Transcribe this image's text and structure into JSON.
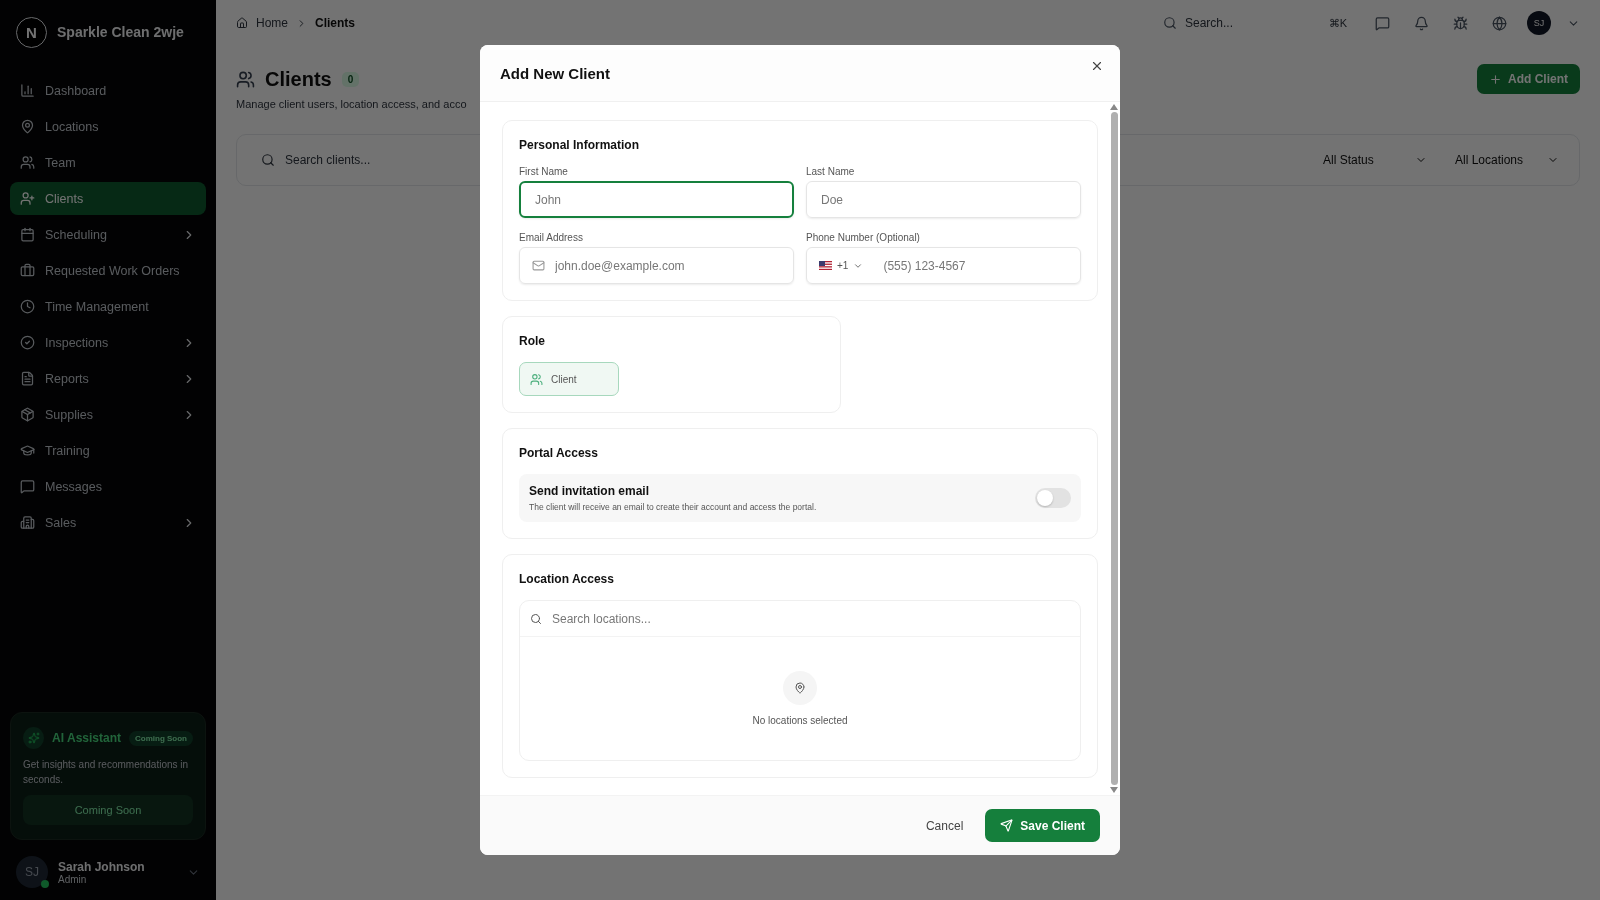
{
  "sidebar": {
    "brand": {
      "logo": "N",
      "name": "Sparkle Clean 2wje"
    },
    "items": [
      {
        "label": "Dashboard",
        "selected": false,
        "expandable": false
      },
      {
        "label": "Locations",
        "selected": false,
        "expandable": false
      },
      {
        "label": "Team",
        "selected": false,
        "expandable": false
      },
      {
        "label": "Clients",
        "selected": true,
        "expandable": false
      },
      {
        "label": "Scheduling",
        "selected": false,
        "expandable": true
      },
      {
        "label": "Requested Work Orders",
        "selected": false,
        "expandable": false
      },
      {
        "label": "Time Management",
        "selected": false,
        "expandable": false
      },
      {
        "label": "Inspections",
        "selected": false,
        "expandable": true
      },
      {
        "label": "Reports",
        "selected": false,
        "expandable": true
      },
      {
        "label": "Supplies",
        "selected": false,
        "expandable": true
      },
      {
        "label": "Training",
        "selected": false,
        "expandable": false
      },
      {
        "label": "Messages",
        "selected": false,
        "expandable": false
      },
      {
        "label": "Sales",
        "selected": false,
        "expandable": true
      }
    ],
    "ai_card": {
      "title": "AI Assistant",
      "badge": "Coming Soon",
      "text": "Get insights and recommendations in seconds.",
      "button": "Coming Soon"
    },
    "user": {
      "initials": "SJ",
      "name": "Sarah Johnson",
      "role": "Admin",
      "online": true
    }
  },
  "header": {
    "breadcrumb": [
      "Home",
      "Clients"
    ],
    "search": {
      "placeholder": "Search...",
      "shortcut": "⌘K"
    },
    "avatar": "SJ"
  },
  "page": {
    "title": "Clients",
    "count": "0",
    "description": "Manage client users, location access, and acco",
    "add_button": "Add Client",
    "search": {
      "placeholder": "Search clients..."
    },
    "filters": [
      "All Status",
      "All Locations"
    ]
  },
  "dialog": {
    "title": "Add New Client",
    "personal": {
      "title": "Personal Information",
      "fields": [
        {
          "label": "First Name",
          "placeholder": "John",
          "focused": true
        },
        {
          "label": "Last Name",
          "placeholder": "Doe",
          "focused": false
        },
        {
          "label": "Email Address",
          "placeholder": "john.doe@example.com",
          "focused": false
        }
      ],
      "phone": {
        "label": "Phone Number (Optional)",
        "code": "+1",
        "placeholder": "(555) 123-4567"
      }
    },
    "role": {
      "title": "Role",
      "options": [
        {
          "label": "Client",
          "selected": true
        }
      ]
    },
    "portal": {
      "title": "Portal Access",
      "invite": {
        "title": "Send invitation email",
        "text": "The client will receive an email to create their account and access the portal.",
        "on": false
      }
    },
    "locations": {
      "title": "Location Access",
      "search": {
        "placeholder": "Search locations..."
      },
      "empty": "No locations selected"
    },
    "buttons": {
      "cancel": "Cancel",
      "save": "Save Client"
    }
  }
}
